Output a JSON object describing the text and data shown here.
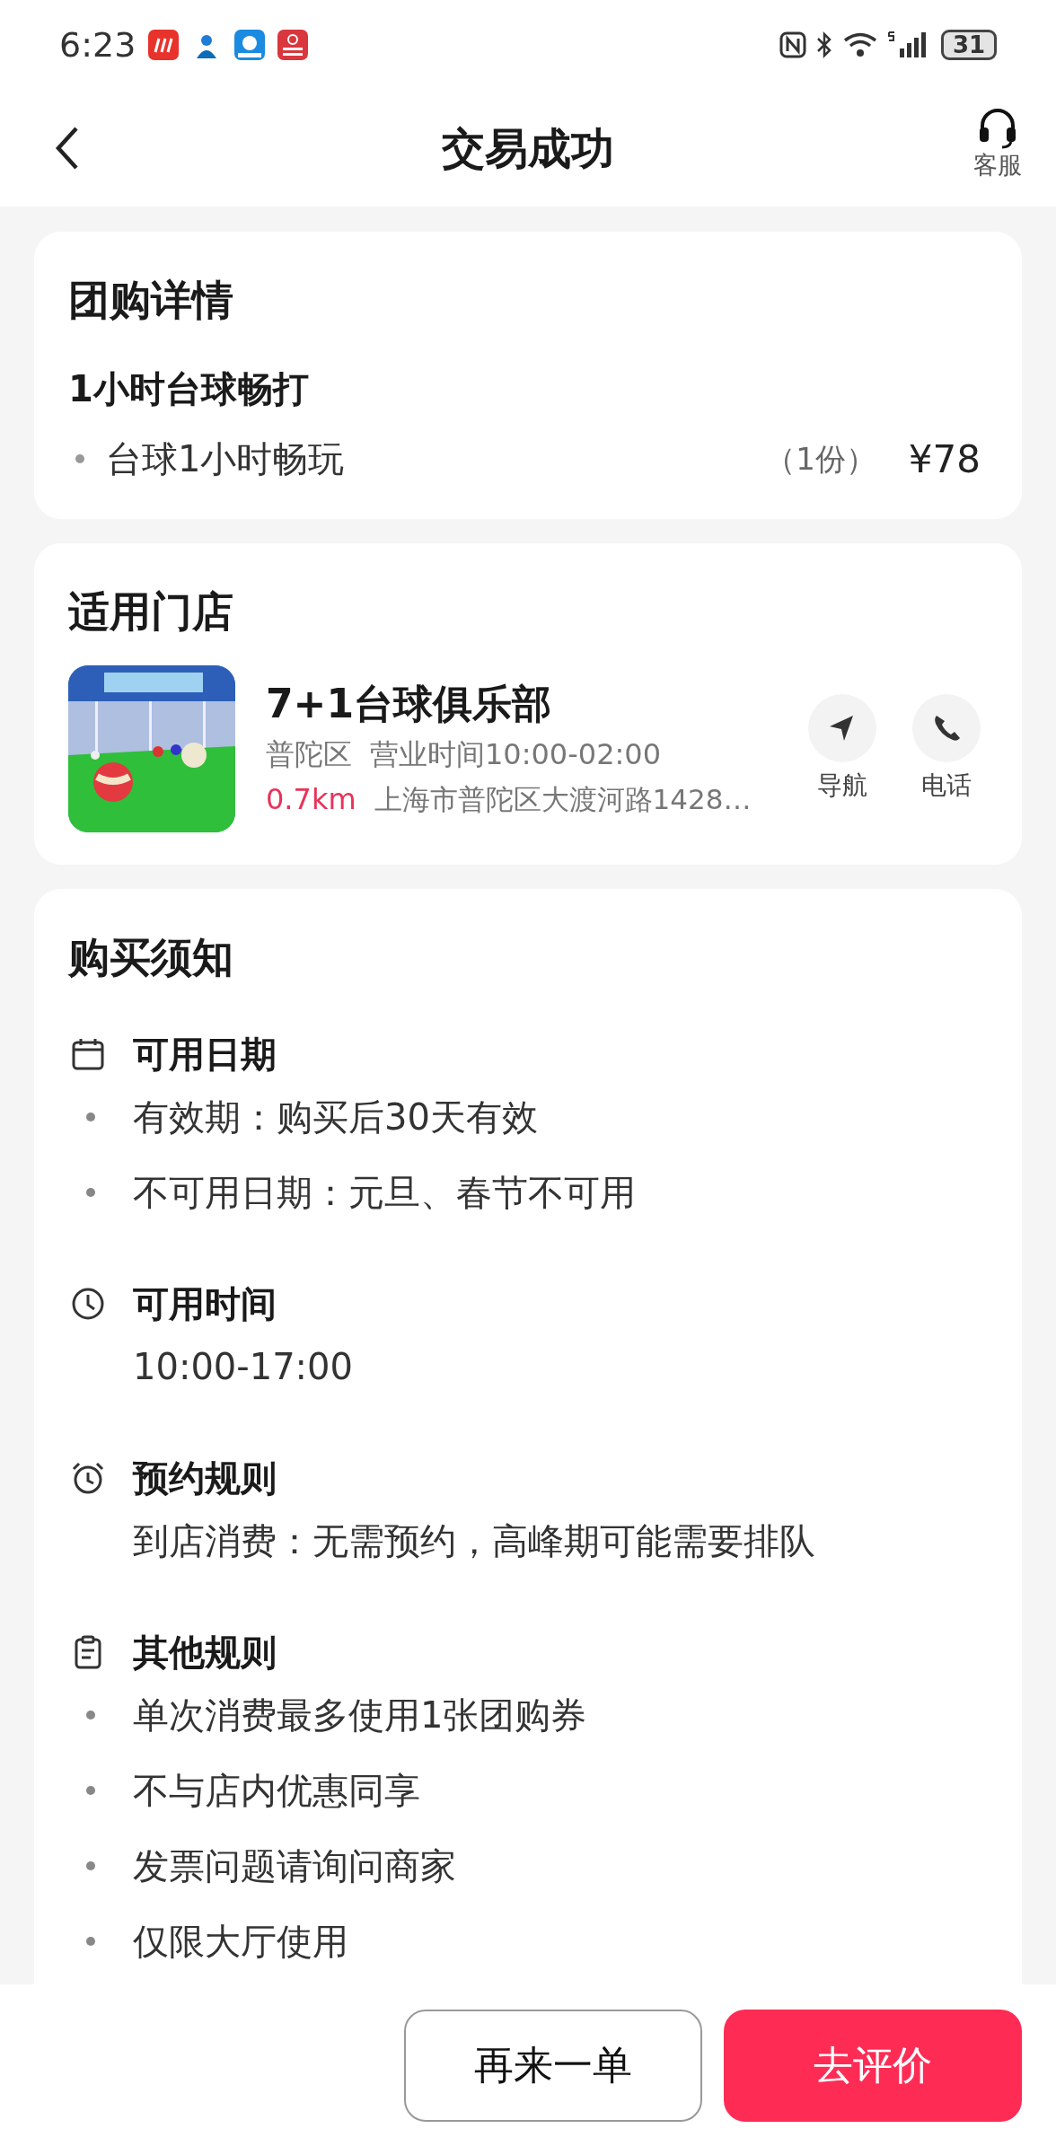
{
  "status_bar": {
    "time": "6:23",
    "battery": "31"
  },
  "header": {
    "title": "交易成功",
    "service_label": "客服"
  },
  "deal_card": {
    "title": "团购详情",
    "package": "1小时台球畅打",
    "items": [
      {
        "name": "台球1小时畅玩",
        "quantity": "（1份）",
        "price": "¥78"
      }
    ]
  },
  "store_card": {
    "title": "适用门店",
    "store": {
      "name": "7+1台球俱乐部",
      "district": "普陀区",
      "hours": "营业时间10:00-02:00",
      "distance": "0.7km",
      "address": "上海市普陀区大渡河路1428…"
    },
    "actions": [
      {
        "kind": "navigate",
        "label": "导航"
      },
      {
        "kind": "phone",
        "label": "电话"
      }
    ]
  },
  "notice_card": {
    "title": "购买须知",
    "sections": [
      {
        "kind": "calendar",
        "title": "可用日期",
        "bulleted": true,
        "lines": [
          "有效期：购买后30天有效",
          "不可用日期：元旦、春节不可用"
        ]
      },
      {
        "kind": "clock",
        "title": "可用时间",
        "bulleted": false,
        "lines": [
          "10:00-17:00"
        ]
      },
      {
        "kind": "alarm",
        "title": "预约规则",
        "bulleted": false,
        "lines": [
          "到店消费：无需预约，高峰期可能需要排队"
        ]
      },
      {
        "kind": "clipboard",
        "title": "其他规则",
        "bulleted": true,
        "lines": [
          "单次消费最多使用1张团购券",
          "不与店内优惠同享",
          "发票问题请询问商家",
          "仅限大厅使用"
        ]
      }
    ]
  },
  "footer": {
    "buttons": [
      {
        "kind": "outline",
        "label": "再来一单"
      },
      {
        "kind": "primary",
        "label": "去评价"
      }
    ]
  }
}
